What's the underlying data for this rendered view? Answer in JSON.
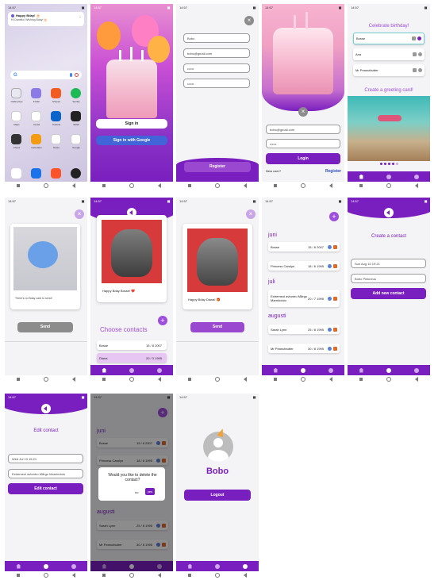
{
  "colors": {
    "accent": "#7a1fbf",
    "light_accent": "#e7c6f3",
    "gray_button": "#8c8c8c"
  },
  "status_bar": {
    "time": "14:57"
  },
  "s1": {
    "notification": {
      "title": "Happy Bday! 🎂",
      "text": "Hi Danello! Wishing Bday! 🎂"
    },
    "apps_row1": [
      "GalleryApp",
      "Folder",
      "Shopee",
      "Spotify"
    ],
    "apps_row2": [
      "Maps",
      "Gmail",
      "Outlook",
      "SMHI"
    ],
    "apps_row3": [
      "Chess",
      "Calculator",
      "Notes",
      "Google"
    ]
  },
  "s2": {
    "sign_in": "Sign in",
    "sign_in_google": "Sign in with Google"
  },
  "s3": {
    "fields": [
      "Bobo",
      "bobo@gmail.com",
      "••••••",
      "••••••"
    ],
    "register": "Register"
  },
  "s4": {
    "email": "bobo@gmail.com",
    "password": "••••••",
    "login": "Login",
    "new_user": "New user?",
    "register_link": "Register"
  },
  "s5": {
    "celebrate": "Celebrate birthday!",
    "contacts": [
      "Bosse",
      "Ana",
      "Mr Peanutbutter"
    ],
    "greeting_title": "Create a greeting card!"
  },
  "s6": {
    "message": "There's no Bday card to send!",
    "send": "Send"
  },
  "s7": {
    "message": "Happy Bday Bosse! ❤️",
    "choose": "Choose contacts",
    "contacts": [
      {
        "name": "Bosse",
        "date": "15 / 8 2007"
      },
      {
        "name": "Diana",
        "date": "20 / 3 1995"
      }
    ]
  },
  "s8": {
    "message": "Happy Bday Diana! 🎁",
    "send": "Send"
  },
  "s9": {
    "months": [
      {
        "name": "juni",
        "rows": [
          {
            "name": "Bosse",
            "date": "15 / 6 2007"
          },
          {
            "name": "Princess Carolyn",
            "date": "18 / 6 1995"
          }
        ]
      },
      {
        "name": "juli",
        "rows": [
          {
            "name": "Extremeol avtontro Mårgo Marnindolo",
            "date": "20 / 7 1995"
          }
        ]
      },
      {
        "name": "augusti",
        "rows": [
          {
            "name": "Sarah Lynn",
            "date": "25 / 8 1995"
          },
          {
            "name": "Mr Peanutbutter",
            "date": "30 / 8 1995"
          }
        ]
      }
    ]
  },
  "s10": {
    "title": "Create a contact",
    "date_value": "Sun Aug 10 19:21",
    "name_value": "Bobo Pinkneus",
    "add_button": "Add new contact"
  },
  "s11": {
    "title": "Edit contact",
    "date_value": "Wed Jul 19 15:21",
    "name_value": "Extremeol avtontro Mårgo Marnindolo",
    "edit_button": "Edit contact"
  },
  "s12": {
    "months": [
      {
        "name": "juni",
        "rows": [
          {
            "name": "Bosse",
            "date": "15 / 6 2007"
          },
          {
            "name": "Princess Carolyn",
            "date": "18 / 6 1995"
          }
        ]
      },
      {
        "name": "augusti",
        "rows": [
          {
            "name": "Sarah Lynn",
            "date": "25 / 8 1995"
          },
          {
            "name": "Mr Peanutbutter",
            "date": "30 / 8 1995"
          }
        ]
      }
    ],
    "dialog": {
      "text": "Would you like to delete the contact?",
      "no": "no",
      "yes": "yes"
    }
  },
  "s13": {
    "name": "Bobo",
    "logout": "Logout"
  }
}
